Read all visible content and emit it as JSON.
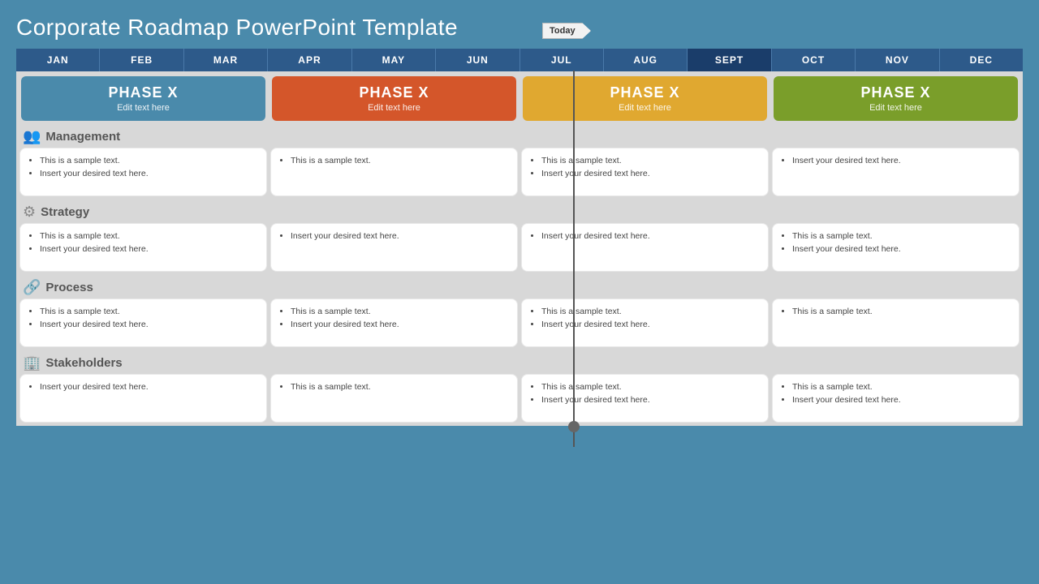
{
  "title": "Corporate Roadmap PowerPoint Template",
  "today_label": "Today",
  "months": [
    {
      "label": "JAN",
      "highlight": false
    },
    {
      "label": "FEB",
      "highlight": false
    },
    {
      "label": "MAR",
      "highlight": false
    },
    {
      "label": "APR",
      "highlight": false
    },
    {
      "label": "MAY",
      "highlight": false
    },
    {
      "label": "JUN",
      "highlight": false
    },
    {
      "label": "JUL",
      "highlight": false
    },
    {
      "label": "AUG",
      "highlight": false
    },
    {
      "label": "SEPT",
      "highlight": true
    },
    {
      "label": "OCT",
      "highlight": false
    },
    {
      "label": "NOV",
      "highlight": false
    },
    {
      "label": "DEC",
      "highlight": false
    }
  ],
  "phases": [
    {
      "label": "PHASE X",
      "sub": "Edit text here",
      "color": "blue"
    },
    {
      "label": "PHASE X",
      "sub": "Edit text here",
      "color": "orange"
    },
    {
      "label": "PHASE X",
      "sub": "Edit text here",
      "color": "yellow"
    },
    {
      "label": "PHASE X",
      "sub": "Edit text here",
      "color": "green"
    }
  ],
  "sections": [
    {
      "name": "Management",
      "icon": "👥",
      "cards": [
        {
          "items": [
            "This is a sample text.",
            "Insert your desired text here."
          ]
        },
        {
          "items": [
            "This is a sample text."
          ]
        },
        {
          "items": [
            "This is a sample text.",
            "Insert your desired text here."
          ]
        },
        {
          "items": [
            "Insert your desired text here."
          ]
        }
      ]
    },
    {
      "name": "Strategy",
      "icon": "⚙",
      "cards": [
        {
          "items": [
            "This is a sample text.",
            "Insert your desired text here."
          ]
        },
        {
          "items": [
            "Insert your desired text here."
          ]
        },
        {
          "items": [
            "Insert your desired text here."
          ]
        },
        {
          "items": [
            "This is a sample text.",
            "Insert your desired text here."
          ]
        }
      ]
    },
    {
      "name": "Process",
      "icon": "🔗",
      "cards": [
        {
          "items": [
            "This is a sample text.",
            "Insert your desired text here."
          ]
        },
        {
          "items": [
            "This is a sample text.",
            "Insert your desired text here."
          ]
        },
        {
          "items": [
            "This is a sample text.",
            "Insert your desired text here."
          ]
        },
        {
          "items": [
            "This is a sample text."
          ]
        }
      ]
    },
    {
      "name": "Stakeholders",
      "icon": "🏢",
      "cards": [
        {
          "items": [
            "Insert your desired text here."
          ]
        },
        {
          "items": [
            "This is a sample text."
          ]
        },
        {
          "items": [
            "This is a sample text.",
            "Insert your desired text here."
          ]
        },
        {
          "items": [
            "This is a sample text.",
            "Insert your desired text here."
          ]
        }
      ]
    }
  ]
}
